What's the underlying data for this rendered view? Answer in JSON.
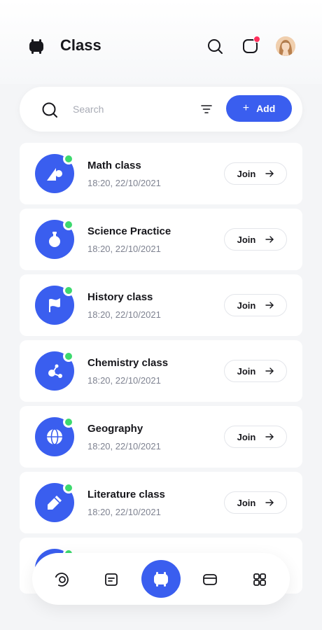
{
  "header": {
    "title": "Class",
    "icons": [
      "app-logo-icon",
      "search-icon",
      "notification-icon",
      "avatar"
    ],
    "notification_dot_color": "#ff2f5c"
  },
  "search": {
    "placeholder": "Search",
    "value": "",
    "filter_icon": "filter-icon",
    "add_label": "Add"
  },
  "colors": {
    "accent": "#3a5eef",
    "online": "#3dd96e",
    "background": "#f4f5f7",
    "card": "#ffffff"
  },
  "classes": [
    {
      "name": "Math class",
      "time": "18:20, 22/10/2021",
      "icon": "geometry-icon",
      "online": true,
      "join_label": "Join"
    },
    {
      "name": "Science Practice",
      "time": "18:20, 22/10/2021",
      "icon": "flask-icon",
      "online": true,
      "join_label": "Join"
    },
    {
      "name": "History class",
      "time": "18:20, 22/10/2021",
      "icon": "flag-icon",
      "online": true,
      "join_label": "Join"
    },
    {
      "name": "Chemistry class",
      "time": "18:20, 22/10/2021",
      "icon": "molecule-icon",
      "online": true,
      "join_label": "Join"
    },
    {
      "name": "Geography",
      "time": "18:20, 22/10/2021",
      "icon": "globe-icon",
      "online": true,
      "join_label": "Join"
    },
    {
      "name": "Literature class",
      "time": "18:20, 22/10/2021",
      "icon": "pencil-icon",
      "online": true,
      "join_label": "Join"
    }
  ],
  "bottom_nav": {
    "items": [
      "dashboard-icon",
      "notes-icon",
      "class-icon",
      "card-icon",
      "grid-icon"
    ],
    "active": "class-icon"
  }
}
